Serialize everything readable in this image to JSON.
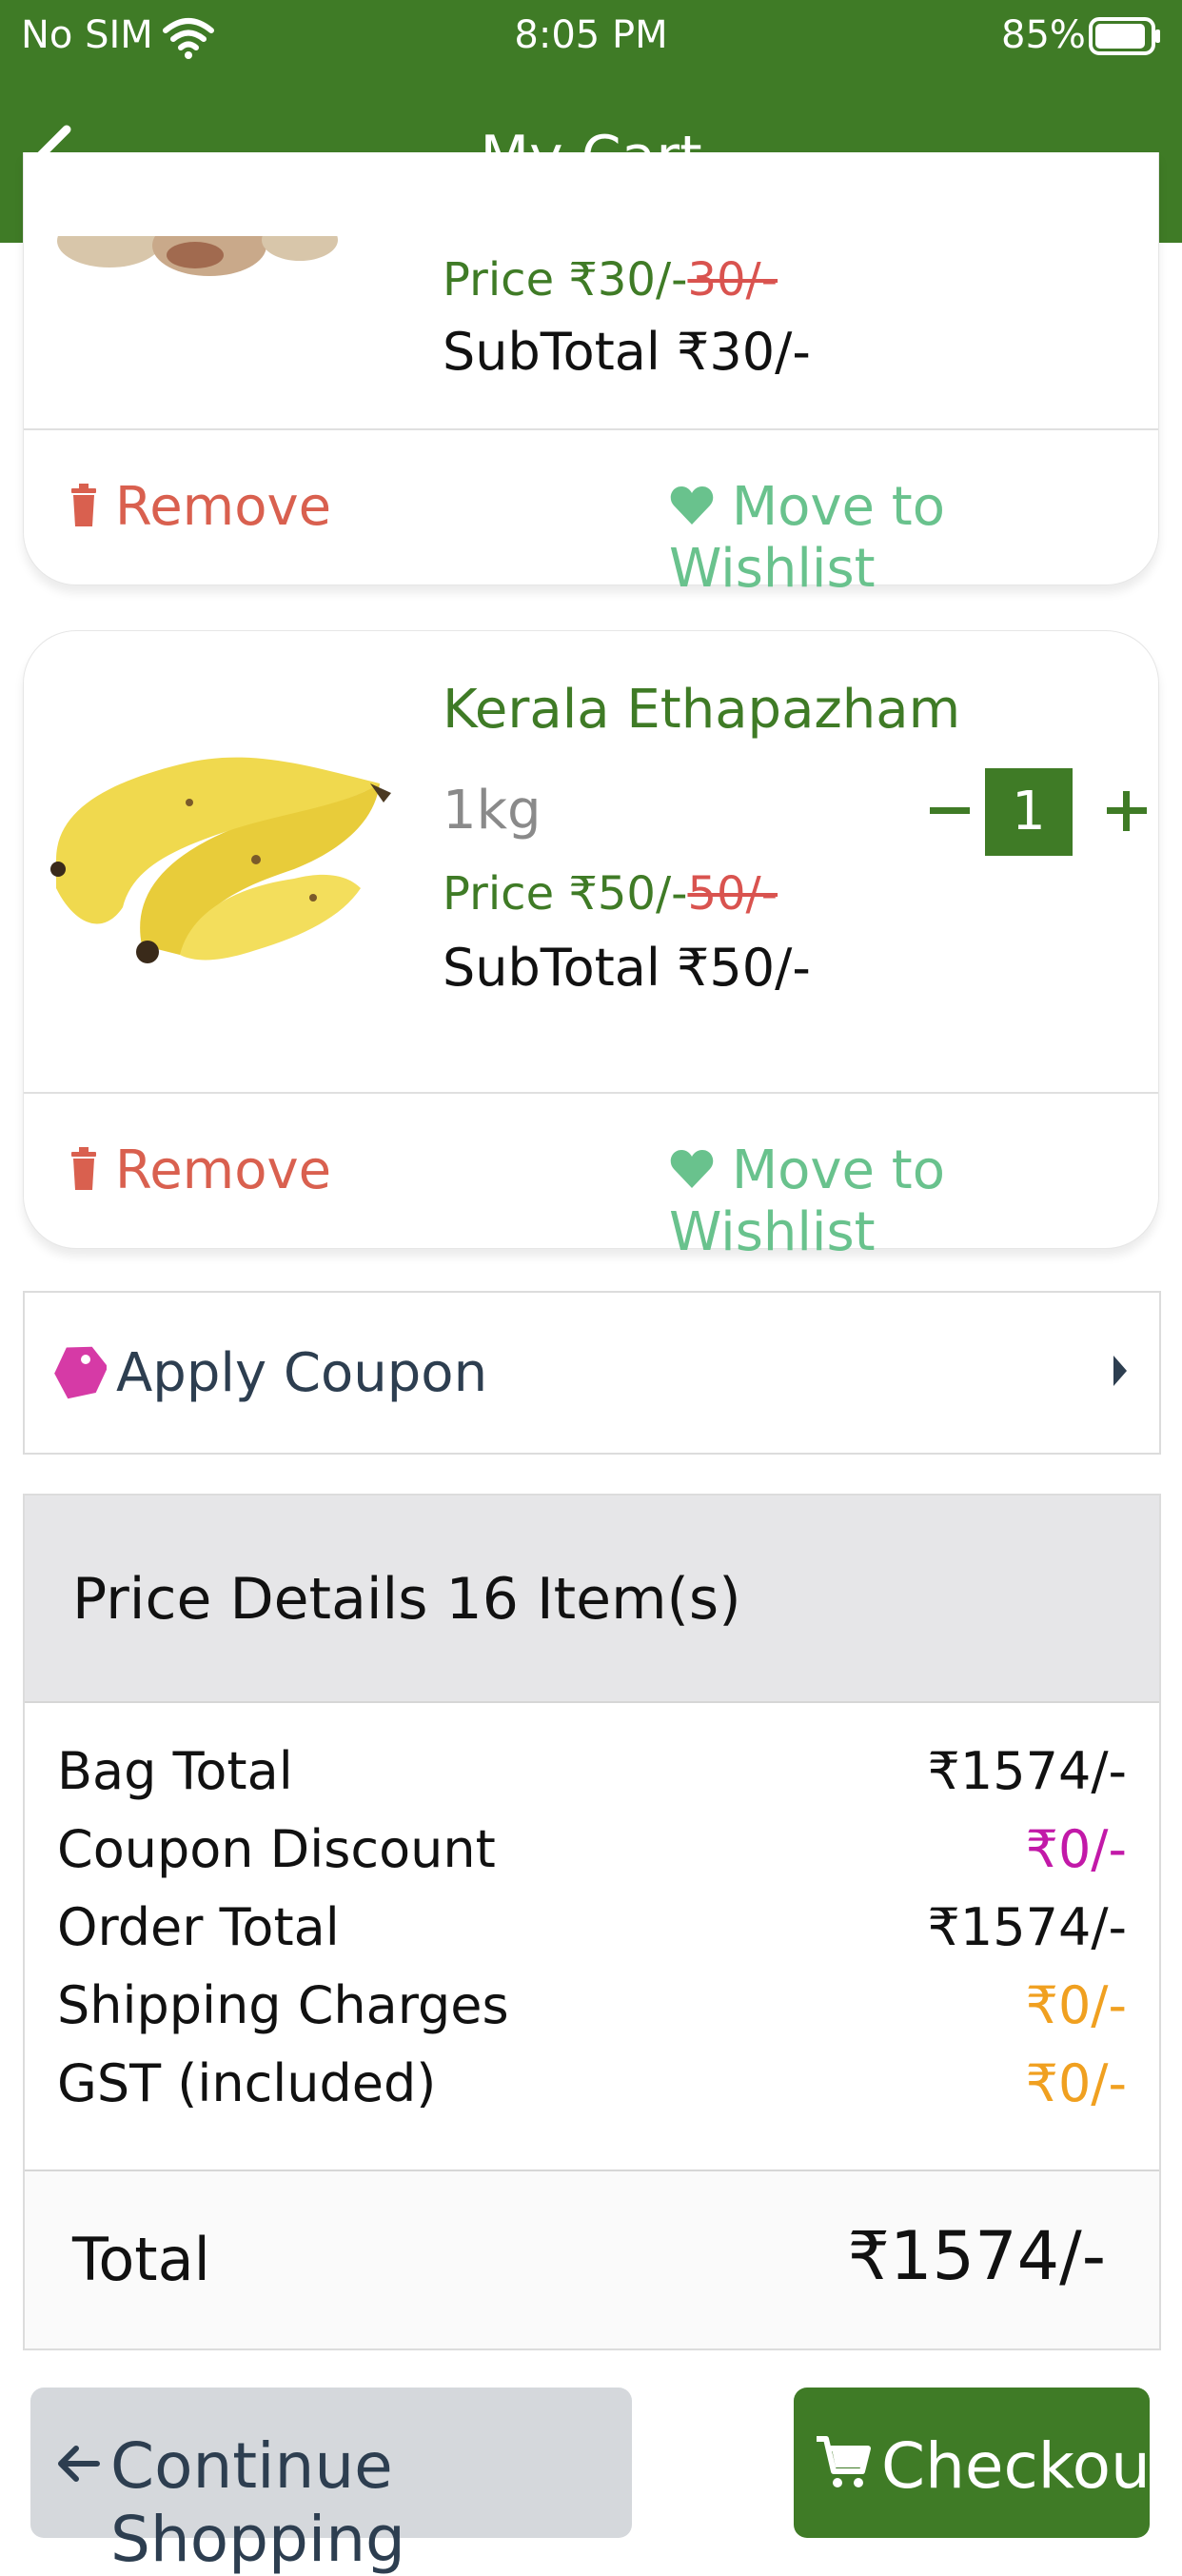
{
  "status_bar": {
    "carrier": "No SIM",
    "time": "8:05 PM",
    "battery": "85%"
  },
  "header": {
    "title": "My Cart"
  },
  "items": [
    {
      "name": "",
      "weight": "",
      "price_label": "Price ₹30/-",
      "old_price": "30/-",
      "subtotal": "SubTotal ₹30/-",
      "remove_label": "Remove",
      "wishlist_label": "Move to Wishlist"
    },
    {
      "name": "Kerala Ethapazham",
      "weight": "1kg",
      "quantity": "1",
      "price_label": "Price ₹50/-",
      "old_price": "50/-",
      "subtotal": "SubTotal ₹50/-",
      "remove_label": "Remove",
      "wishlist_label": "Move to Wishlist"
    }
  ],
  "coupon": {
    "label": "Apply Coupon"
  },
  "price_details": {
    "heading": "Price Details 16 Item(s)",
    "rows": [
      {
        "label": "Bag Total",
        "value": "₹1574/-",
        "color": "#111111"
      },
      {
        "label": "Coupon Discount",
        "value": "₹0/-",
        "color": "#c219a8"
      },
      {
        "label": "Order Total",
        "value": "₹1574/-",
        "color": "#111111"
      },
      {
        "label": "Shipping Charges",
        "value": "₹0/-",
        "color": "#f0a020"
      },
      {
        "label": "GST (included)",
        "value": "₹0/-",
        "color": "#f0a020"
      }
    ],
    "total_label": "Total",
    "total_value": "₹1574/-"
  },
  "buttons": {
    "continue": "Continue Shopping",
    "checkout": "Checkout"
  },
  "colors": {
    "brand": "#3f7b26",
    "remove": "#d9604f",
    "wishlist": "#69c28d",
    "coupon_tag": "#d63aa6"
  }
}
